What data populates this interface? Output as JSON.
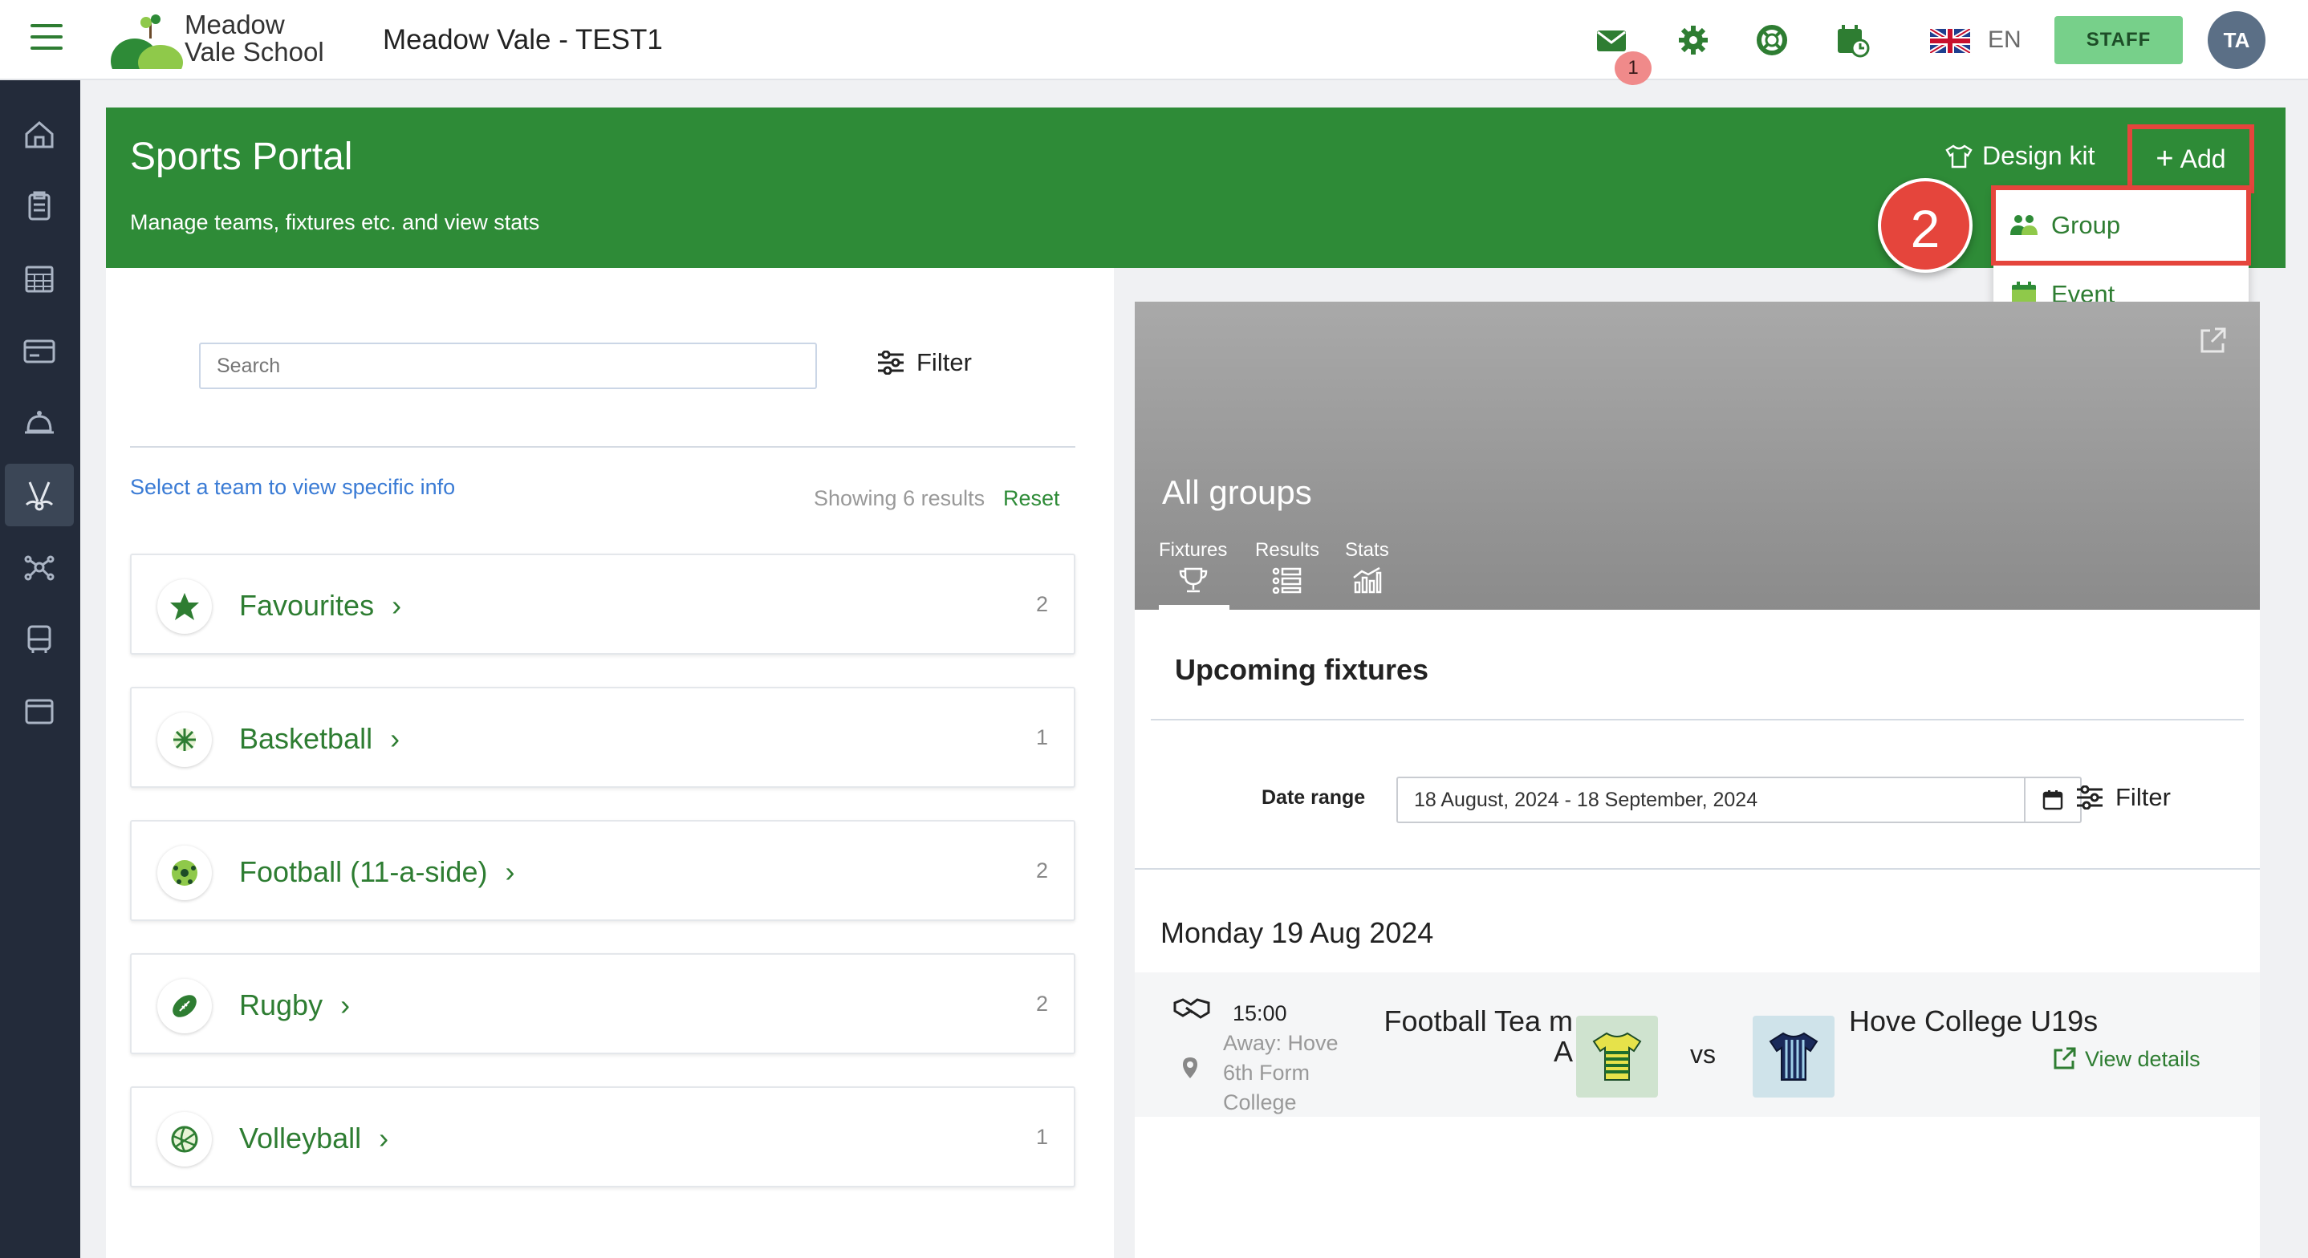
{
  "app": {
    "logo_line1": "Meadow",
    "logo_line2": "Vale School",
    "title": "Meadow Vale - TEST1"
  },
  "topbar": {
    "mail_badge": "1",
    "language": "EN",
    "staff_label": "STAFF",
    "avatar_initials": "TA",
    "icons": [
      "mail-icon",
      "gear-icon",
      "lifebuoy-icon",
      "calendar-clock-icon",
      "uk-flag-icon"
    ]
  },
  "sidebar": {
    "items": [
      "home-icon",
      "clipboard-icon",
      "calendar-grid-icon",
      "card-icon",
      "bell-icon",
      "sports-icon",
      "network-icon",
      "bus-icon",
      "window-icon"
    ],
    "active": "sports-icon"
  },
  "header": {
    "title": "Sports Portal",
    "subtitle": "Manage teams, fixtures etc. and view stats",
    "design_kit_label": "Design kit",
    "add_label": "Add"
  },
  "dropdown": {
    "items": [
      {
        "label": "Group",
        "icon": "group-icon"
      },
      {
        "label": "Event",
        "icon": "calendar-icon"
      }
    ]
  },
  "step_marker": "2",
  "left": {
    "search_placeholder": "Search",
    "filter_label": "Filter",
    "select_hint": "Select a team to view specific info",
    "showing": "Showing 6 results",
    "reset": "Reset",
    "teams": [
      {
        "name": "Favourites",
        "count": "2",
        "icon": "star-icon"
      },
      {
        "name": "Basketball",
        "count": "1",
        "icon": "basketball-icon"
      },
      {
        "name": "Football (11-a-side)",
        "count": "2",
        "icon": "football-icon"
      },
      {
        "name": "Rugby",
        "count": "2",
        "icon": "rugby-icon"
      },
      {
        "name": "Volleyball",
        "count": "1",
        "icon": "volleyball-icon"
      }
    ]
  },
  "right": {
    "hero_title": "All groups",
    "tabs": [
      "Fixtures",
      "Results",
      "Stats"
    ],
    "upcoming_title": "Upcoming fixtures",
    "date_range_label": "Date range",
    "date_range_value": "18 August, 2024 - 18 September, 2024",
    "filter_label": "Filter",
    "day_heading": "Monday 19 Aug 2024",
    "fixture": {
      "time": "15:00",
      "location": "Away: Hove 6th Form College",
      "team_a": "Football Tea m A",
      "vs": "vs",
      "team_b": "Hove College U19s",
      "view_details": "View details"
    }
  },
  "colors": {
    "brand_green": "#2e8b37",
    "highlight_red": "#e5453c",
    "sidebar_bg": "#232b3a",
    "staff_btn": "#77d08a"
  }
}
